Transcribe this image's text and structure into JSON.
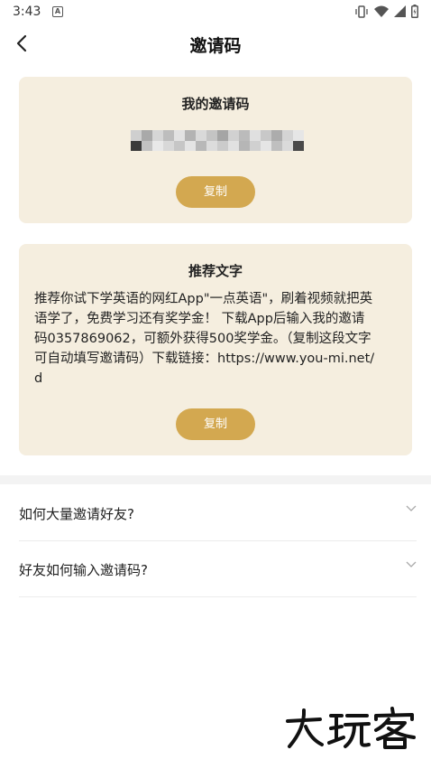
{
  "status_bar": {
    "time": "3:43",
    "notification_icon": "a-letter-icon",
    "right_icons": [
      "vibrate-icon",
      "wifi-icon",
      "signal-icon",
      "battery-icon"
    ]
  },
  "nav": {
    "title": "邀请码",
    "back_icon": "chevron-left-icon"
  },
  "invite_card": {
    "title": "我的邀请码",
    "code_obscured": true,
    "copy_label": "复制"
  },
  "recommend_card": {
    "title": "推荐文字",
    "text": "推荐你试下学英语的网红App\"一点英语\"，刷着视频就把英语学了，免费学习还有奖学金！ 下载App后输入我的邀请码0357869062，可额外获得500奖学金。（复制这段文字可自动填写邀请码）下载链接：https://www.you-mi.net/d",
    "copy_label": "复制"
  },
  "faq": [
    {
      "label": "如何大量邀请好友?",
      "icon": "chevron-down-icon"
    },
    {
      "label": "好友如何输入邀请码?",
      "icon": "chevron-down-icon"
    }
  ],
  "colors": {
    "card_bg": "#f5eedf",
    "accent": "#d3a850"
  }
}
